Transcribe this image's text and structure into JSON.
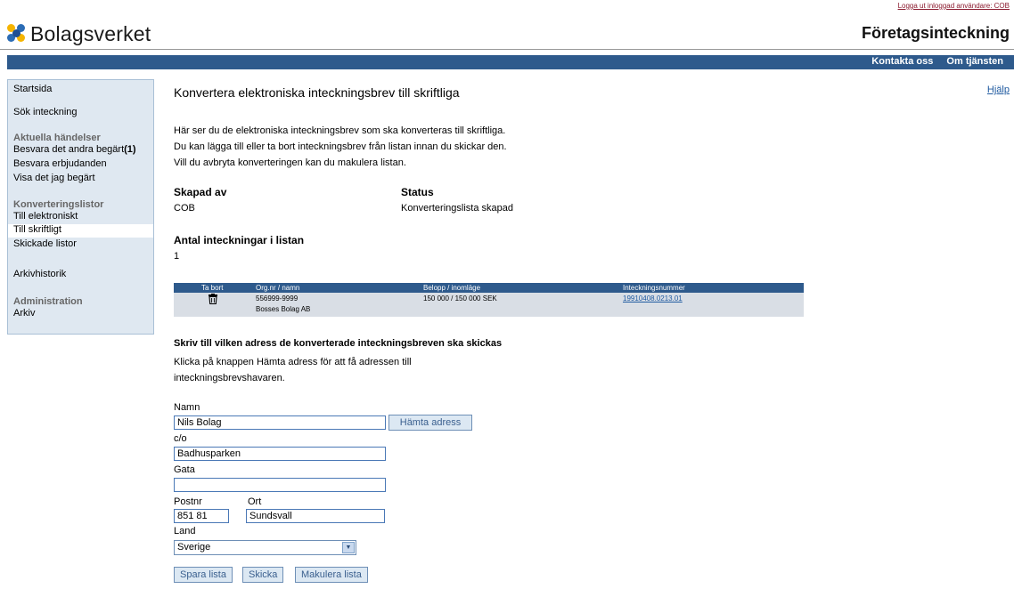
{
  "header": {
    "logout_link": "Logga ut inloggad användare: COB",
    "logo_text": "Bolagsverket",
    "service_title": "Företagsinteckning",
    "nav": [
      "Kontakta oss",
      "Om tjänsten"
    ]
  },
  "sidebar": {
    "startsida": "Startsida",
    "sok": "Sök inteckning",
    "aktuella_heading": "Aktuella händelser",
    "besvara_andra": "Besvara det andra begärt",
    "besvara_andra_count": "(1)",
    "besvara_erbjudanden": "Besvara erbjudanden",
    "visa": "Visa det jag begärt",
    "konvertering_heading": "Konverteringslistor",
    "till_elektroniskt": "Till elektroniskt",
    "till_skriftligt": "Till skriftligt",
    "skickade": "Skickade listor",
    "arkivhistorik": "Arkivhistorik",
    "administration_heading": "Administration",
    "arkiv": "Arkiv"
  },
  "main": {
    "title": "Konvertera elektroniska inteckningsbrev till skriftliga",
    "help_link": "Hjälp",
    "intro": [
      "Här ser du de elektroniska inteckningsbrev som ska konverteras till skriftliga.",
      "Du kan lägga till eller ta bort inteckningsbrev från listan innan du skickar den.",
      "Vill du avbryta konverteringen kan du makulera listan."
    ],
    "created_by_label": "Skapad av",
    "created_by_value": "COB",
    "status_label": "Status",
    "status_value": "Konverteringslista skapad",
    "count_label": "Antal inteckningar i listan",
    "count_value": "1"
  },
  "table": {
    "headers": [
      "Ta bort",
      "Org.nr / namn",
      "Belopp / inomläge",
      "Inteckningsnummer"
    ],
    "row": {
      "orgnr": "556999-9999",
      "name": "Bosses Bolag AB",
      "belopp": "150 000 / 150 000 SEK",
      "nummer": "19910408.0213.01"
    }
  },
  "form": {
    "heading": "Skriv till vilken adress de konverterade inteckningsbreven ska skickas",
    "instructions": [
      "Klicka på knappen Hämta adress för att få adressen till",
      "inteckningsbrevshavaren."
    ],
    "namn_label": "Namn",
    "namn_value": "Nils Bolag",
    "hamta_button": "Hämta adress",
    "co_label": "c/o",
    "co_value": "Badhusparken",
    "gata_label": "Gata",
    "gata_value": "",
    "postnr_label": "Postnr",
    "postnr_value": "851 81",
    "ort_label": "Ort",
    "ort_value": "Sundsvall",
    "land_label": "Land",
    "land_value": "Sverige",
    "buttons": [
      "Spara lista",
      "Skicka",
      "Makulera lista"
    ]
  },
  "colors": {
    "bar": "#2e5a8c",
    "sidebar_bg": "#dfe8f1",
    "link": "#1f5aa0",
    "logout": "#8b1a2e"
  }
}
